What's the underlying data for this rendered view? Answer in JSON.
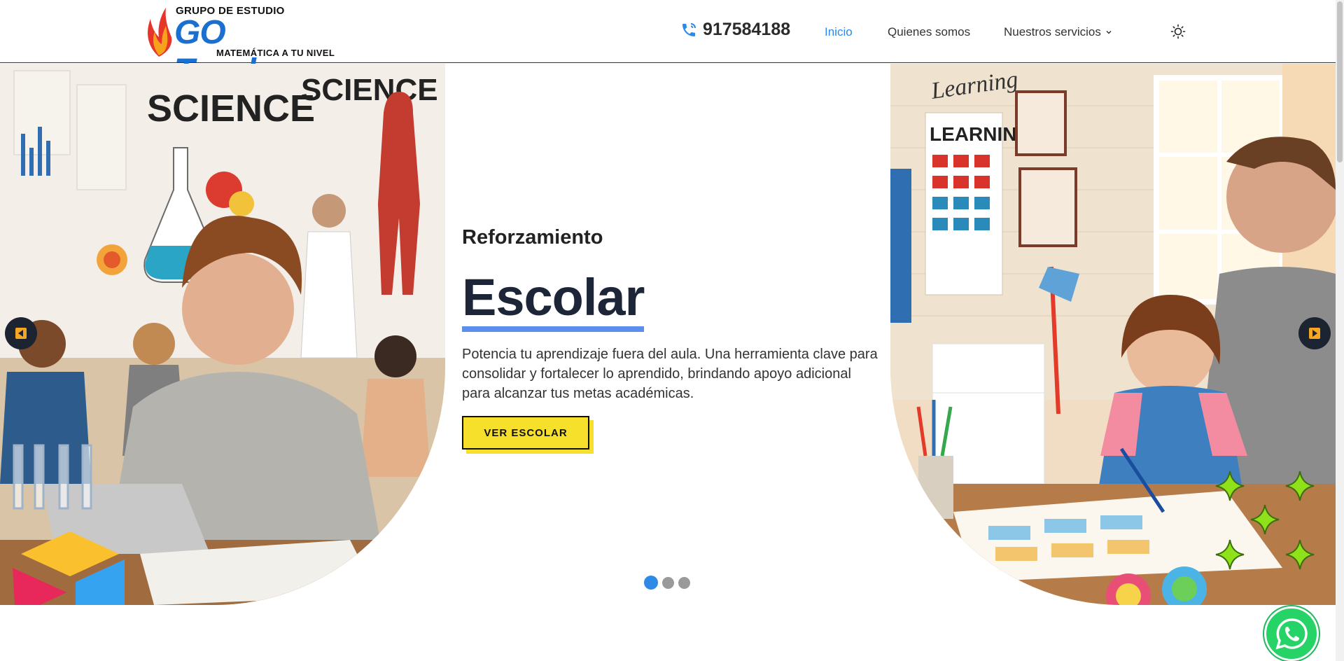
{
  "header": {
    "logo": {
      "top_text": "GRUPO DE ESTUDIO",
      "main_text": "GO Teacher",
      "sub_text": "MATEMÁTICA A TU NIVEL"
    },
    "phone": "917584188",
    "nav": {
      "home": "Inicio",
      "about": "Quienes somos",
      "services": "Nuestros servicios"
    }
  },
  "hero": {
    "subtitle": "Reforzamiento",
    "title": "Escolar",
    "description": "Potencia tu aprendizaje fuera del aula. Una herramienta clave para consolidar y fortalecer lo aprendido, brindando apoyo adicional para alcanzar tus metas académicas.",
    "cta_label": "VER ESCOLAR",
    "slides_count": 3,
    "active_slide": 1,
    "left_image_text": [
      "SCIENCE",
      "SCIENCE"
    ],
    "right_image_text": [
      "Learning",
      "LEARNING"
    ]
  },
  "colors": {
    "accent": "#2e8ae6",
    "cta": "#f7e02b",
    "title": "#1d2638",
    "underline": "#5b8dee",
    "whatsapp": "#25d366"
  },
  "icons": [
    "phone-icon",
    "chevron-down-icon",
    "sun-icon",
    "arrow-left-icon",
    "arrow-right-icon",
    "whatsapp-icon",
    "sparkle-icon",
    "cube-icon"
  ]
}
